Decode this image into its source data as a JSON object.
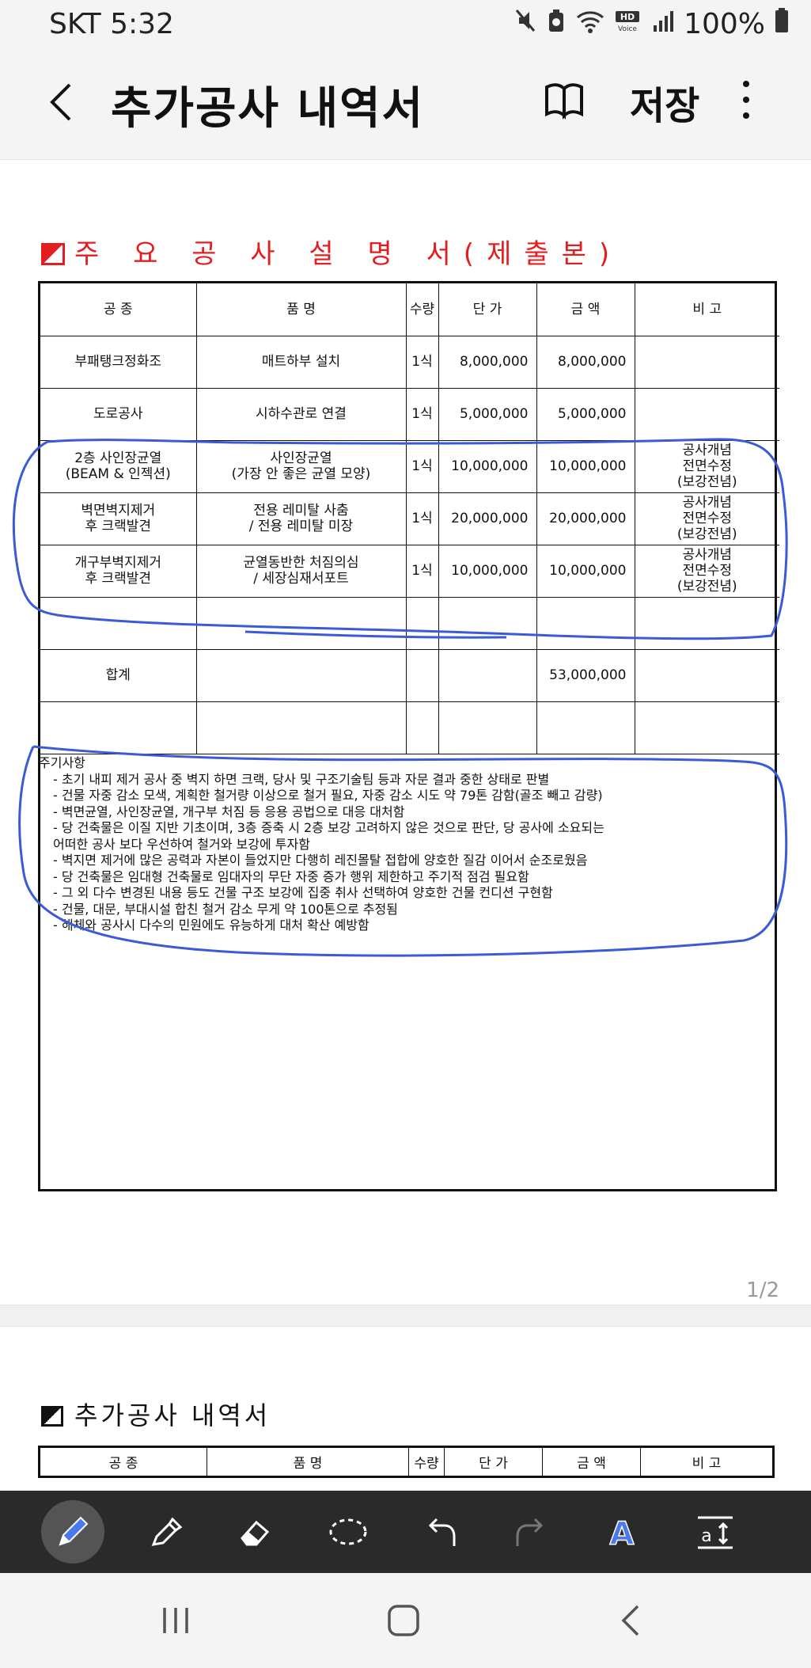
{
  "status_bar": {
    "carrier_time": "SKT 5:32",
    "battery": "100%",
    "icons": [
      "mute-icon",
      "recycle-icon",
      "wifi-icon",
      "hd-voice-icon",
      "signal-icon",
      "battery-icon"
    ]
  },
  "app_bar": {
    "title": "추가공사 내역서",
    "save_label": "저장",
    "icons": [
      "back-arrow-icon",
      "book-icon",
      "more-vertical-icon"
    ]
  },
  "document": {
    "section_title": "주 요 공 사 설 명 서(제출본)",
    "table": {
      "headers": [
        "공 종",
        "품 명",
        "수량",
        "단 가",
        "금 액",
        "비 고"
      ],
      "rows": [
        {
          "trade": "부패탱크정화조",
          "item": "매트하부 설치",
          "qty": "1식",
          "unit_price": "8,000,000",
          "amount": "8,000,000",
          "remark": ""
        },
        {
          "trade": "도로공사",
          "item": "시하수관로 연결",
          "qty": "1식",
          "unit_price": "5,000,000",
          "amount": "5,000,000",
          "remark": ""
        },
        {
          "trade": "2층 사인장균열\n(BEAM & 인젝션)",
          "item": "사인장균열\n(가장 안 좋은 균열 모양)",
          "qty": "1식",
          "unit_price": "10,000,000",
          "amount": "10,000,000",
          "remark": "공사개념\n전면수정\n(보강전념)"
        },
        {
          "trade": "벽면벽지제거\n후 크랙발견",
          "item": "전용 레미탈 사춤\n/ 전용 레미탈 미장",
          "qty": "1식",
          "unit_price": "20,000,000",
          "amount": "20,000,000",
          "remark": "공사개념\n전면수정\n(보강전념)"
        },
        {
          "trade": "개구부벽지제거\n후 크랙발견",
          "item": "균열동반한 처짐의심\n/ 세장심재서포트",
          "qty": "1식",
          "unit_price": "10,000,000",
          "amount": "10,000,000",
          "remark": "공사개념\n전면수정\n(보강전념)"
        },
        {
          "trade": "",
          "item": "",
          "qty": "",
          "unit_price": "",
          "amount": "",
          "remark": ""
        },
        {
          "trade": "합계",
          "item": "",
          "qty": "",
          "unit_price": "",
          "amount": "53,000,000",
          "remark": ""
        },
        {
          "trade": "",
          "item": "",
          "qty": "",
          "unit_price": "",
          "amount": "",
          "remark": ""
        }
      ]
    },
    "notes_heading": "주기사항",
    "notes": [
      "- 초기 내피 제거 공사 중 벽지 하면 크랙, 당사 및 구조기술팀 등과 자문 결과 중한 상태로 판별",
      "- 건물 자중 감소 모색, 계획한 철거량 이상으로 철거 필요, 자중 감소 시도 약 79톤 감함(골조 빼고 감량)",
      "- 벽면균열, 사인장균열, 개구부 처짐 등 응용 공법으로 대응 대처함",
      "- 당 건축물은 이질 지반 기초이며, 3층 증축 시 2층 보강 고려하지 않은 것으로 판단, 당 공사에 소요되는",
      "  어떠한 공사 보다 우선하여 철거와 보강에 투자함",
      "- 벽지면 제거에 많은 공력과 자본이 들었지만 다행히 레진몰탈 접합에 양호한 질감 이어서 순조로웠음",
      "- 당 건축물은 임대형 건축물로 임대자의 무단 자중 증가 행위 제한하고 주기적 점검 필요함",
      "- 그 외 다수 변경된 내용 등도 건물 구조 보강에 집중 취사 선택하여 양호한 건물 컨디션 구현함",
      "- 건물, 대문, 부대시설 합친 철거 감소 무게 약 100톤으로 추정됨",
      "- 해체와 공사시 다수의 민원에도 유능하게 대처 확산 예방함"
    ],
    "page_indicator": "1/2",
    "page2": {
      "title": "추가공사 내역서",
      "headers": [
        "공 종",
        "품 명",
        "수량",
        "단 가",
        "금 액",
        "비 고"
      ]
    },
    "annotation_color": "#3b5bd6"
  },
  "pen_toolbar": {
    "tools": [
      "pen-icon",
      "highlighter-icon",
      "eraser-icon",
      "lasso-icon",
      "undo-icon",
      "redo-icon",
      "text-style-icon",
      "text-size-icon"
    ],
    "active_tool": "pen-icon"
  },
  "nav_bar": {
    "buttons": [
      "recent-apps-icon",
      "home-icon",
      "back-icon"
    ]
  }
}
